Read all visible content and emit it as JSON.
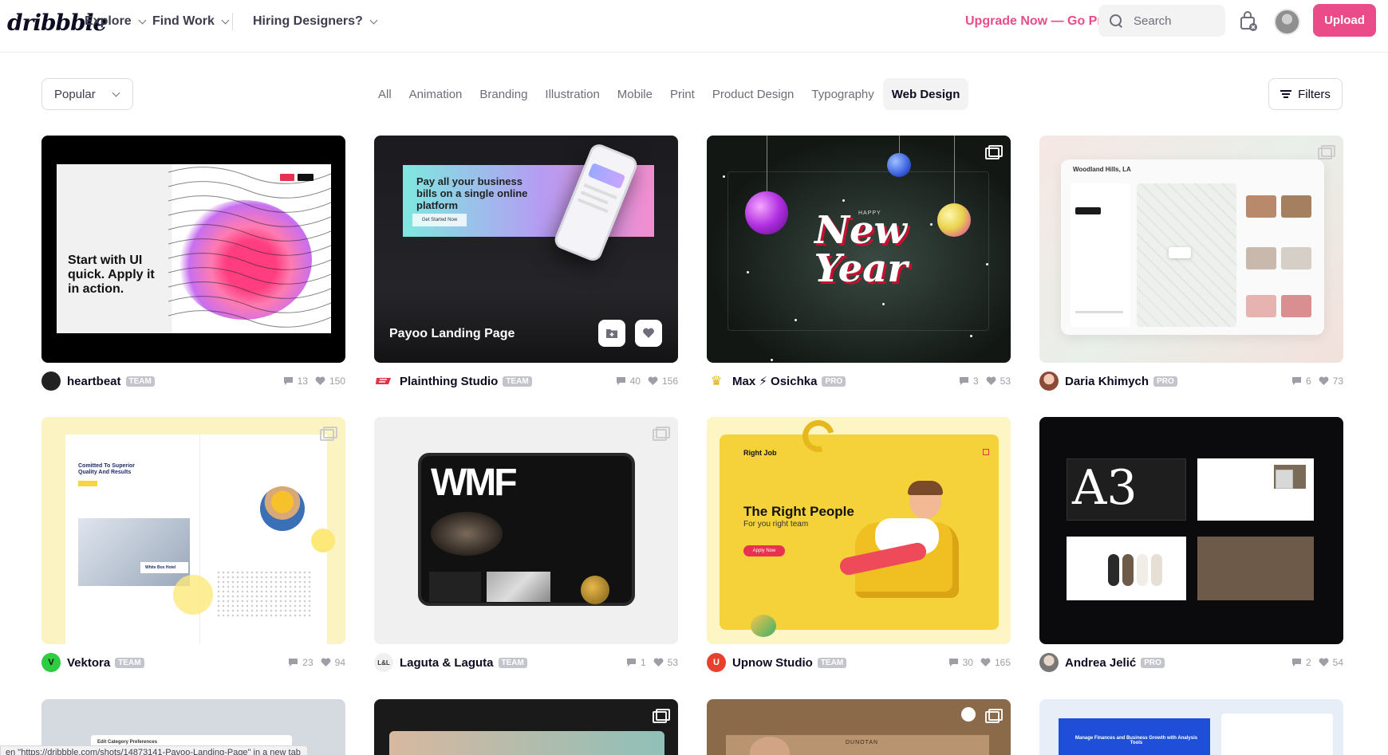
{
  "header": {
    "logo": "dribbble",
    "nav": [
      "Explore",
      "Find Work",
      "Hiring Designers?"
    ],
    "go_pro": "Upgrade Now — Go Pro",
    "search_placeholder": "Search",
    "upload_label": "Upload"
  },
  "filter_bar": {
    "sort_value": "Popular",
    "categories": [
      "All",
      "Animation",
      "Branding",
      "Illustration",
      "Mobile",
      "Print",
      "Product Design",
      "Typography",
      "Web Design"
    ],
    "active_category": "Web Design",
    "filters_label": "Filters"
  },
  "shots": [
    {
      "author": "heartbeat",
      "badge": "TEAM",
      "comments": "13",
      "likes": "150",
      "thumb_text": "Start with UI quick. Apply it in action.",
      "avatar_color": "#222222"
    },
    {
      "author": "Plainthing Studio",
      "badge": "TEAM",
      "comments": "40",
      "likes": "156",
      "thumb_text": "Pay all your business bills on a single online platform",
      "hover_title": "Payoo Landing Page",
      "cta": "Get Started Now",
      "avatar_color": "#e0314d"
    },
    {
      "author": "Max ⚡ Osichka",
      "badge": "PRO",
      "comments": "3",
      "likes": "53",
      "thumb_text": "New Year",
      "thumb_small": "HAPPY",
      "avatar_color": "#f1c40f"
    },
    {
      "author": "Daria Khimych",
      "badge": "PRO",
      "comments": "6",
      "likes": "73",
      "thumb_text": "Woodland Hills, LA",
      "avatar_color": "#c9836b"
    },
    {
      "author": "Vektora",
      "badge": "TEAM",
      "comments": "23",
      "likes": "94",
      "thumb_text": "Comitted To Superior Quality And Results",
      "thumb_small": "White Box Hotel",
      "avatar_color": "#2ecc40"
    },
    {
      "author": "Laguta & Laguta",
      "badge": "TEAM",
      "comments": "1",
      "likes": "53",
      "thumb_text": "WMF",
      "avatar_color": "#f0f0f0"
    },
    {
      "author": "Upnow Studio",
      "badge": "TEAM",
      "comments": "30",
      "likes": "165",
      "thumb_text": "The Right People",
      "thumb_small": "For you right team",
      "cta": "Apply Now",
      "label": "Right Job",
      "avatar_color": "#e8402f"
    },
    {
      "author": "Andrea Jelić",
      "badge": "PRO",
      "comments": "2",
      "likes": "54",
      "thumb_text": "A3",
      "avatar_color": "#b0b0b0"
    }
  ],
  "peek_shots": [
    {
      "thumb_text": "Edit Category Preferences"
    },
    {
      "thumb_text": ""
    },
    {
      "thumb_text": "DUNOTAN"
    },
    {
      "thumb_text": "Manage Finances and Business Growth with Analysis Tools"
    }
  ],
  "status_bar": "en \"https://dribbble.com/shots/14873141-Payoo-Landing-Page\" in a new tab",
  "colors": {
    "accent": "#ea4c89",
    "text": "#0d0c22",
    "muted": "#6e6d7a"
  }
}
